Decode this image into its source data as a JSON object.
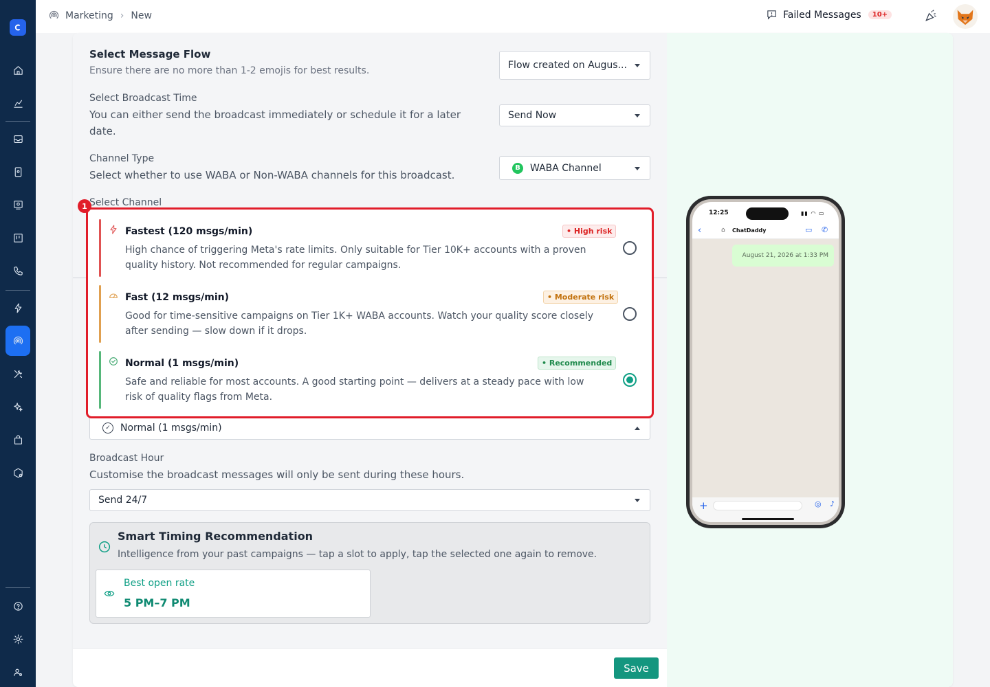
{
  "breadcrumb": {
    "section": "Marketing",
    "page": "New"
  },
  "header": {
    "failed_label": "Failed Messages",
    "failed_count": "10+"
  },
  "flow": {
    "title": "Select Message Flow",
    "desc": "Ensure there are no more than 1-2 emojis for best results.",
    "value": "Flow created on Augus..."
  },
  "broadcast_time": {
    "label": "Select Broadcast Time",
    "desc": "You can either send the broadcast immediately or schedule it for a later date.",
    "value": "Send Now"
  },
  "channel_type": {
    "label": "Channel Type",
    "desc": "Select whether to use WABA or Non-WABA channels for this broadcast.",
    "value": "WABA Channel"
  },
  "select_channel": {
    "label": "Select Channel",
    "marker": "1"
  },
  "speed_options": [
    {
      "title": "Fastest (120 msgs/min)",
      "desc": "High chance of triggering Meta's rate limits. Only suitable for Tier 10K+ accounts with a proven quality history. Not recommended for regular campaigns.",
      "tag": "• High risk",
      "color": "#e05252",
      "selected": false
    },
    {
      "title": "Fast (12 msgs/min)",
      "desc": "Good for time-sensitive campaigns on Tier 1K+ WABA accounts. Watch your quality score closely after sending — slow down if it drops.",
      "tag": "• Moderate risk",
      "color": "#e0a050",
      "selected": false
    },
    {
      "title": "Normal (1 msgs/min)",
      "desc": "Safe and reliable for most accounts. A good starting point — delivers at a steady pace with low risk of quality flags from Meta.",
      "tag": "• Recommended",
      "color": "#56b77a",
      "selected": true
    }
  ],
  "speed_select": {
    "value": "Normal (1 msgs/min)"
  },
  "broadcast_hour": {
    "label": "Broadcast Hour",
    "desc": "Customise the broadcast messages will only be sent during these hours.",
    "value": "Send 24/7"
  },
  "smart_timing": {
    "title": "Smart Timing Recommendation",
    "desc": "Intelligence from your past campaigns — tap a slot to apply, tap the selected one again to remove.",
    "best_label": "Best open rate",
    "best_value": "5 PM–7 PM"
  },
  "footer": {
    "save_label": "Save"
  },
  "preview": {
    "time": "12:25",
    "contact": "ChatDaddy",
    "bubble": "August 21, 2026 at 1:33 PM"
  },
  "colors": {
    "accent": "#14967f",
    "sidebar": "#0f2a4a",
    "highlight": "#e11d2a"
  }
}
